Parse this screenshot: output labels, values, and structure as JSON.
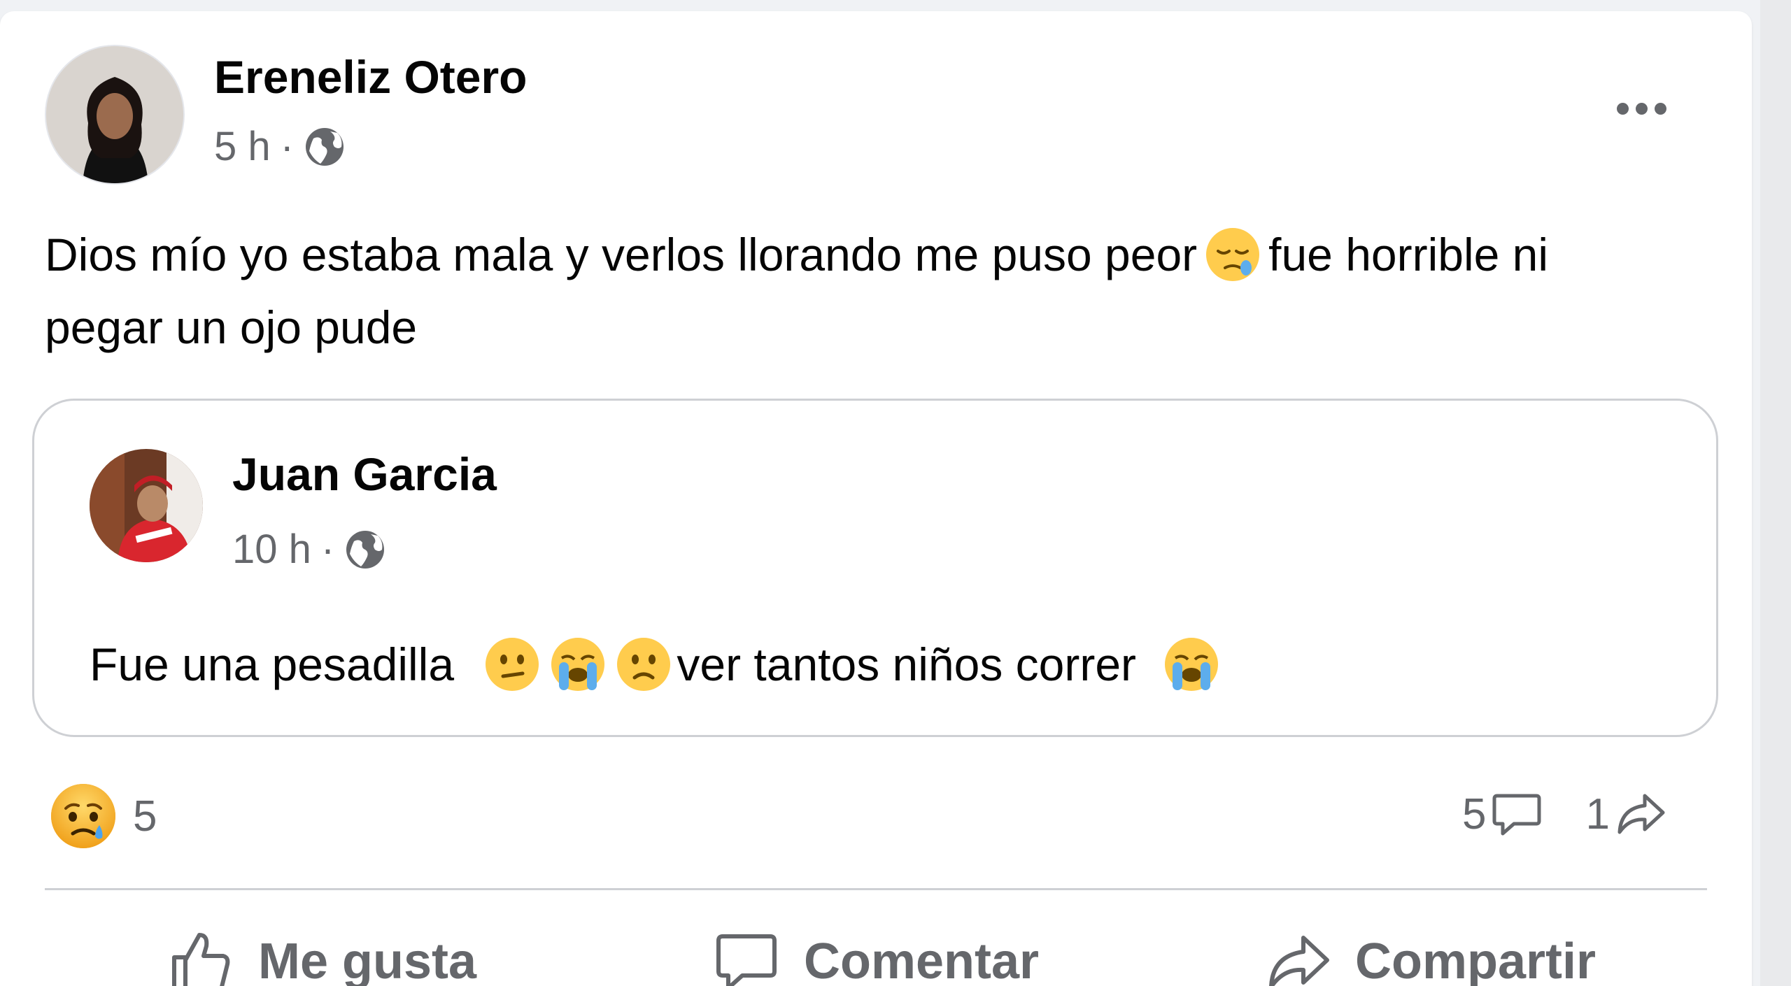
{
  "post": {
    "author": "Ereneliz Otero",
    "time": "5 h",
    "separator": "·",
    "text_part1": "Dios mío yo estaba mala y verlos llorando me puso peor",
    "text_part2": "fue horrible ni pegar un ojo pude",
    "icons": {
      "more": "more-options-icon",
      "audience": "globe-icon",
      "inline_emoji": "sleepy-face-emoji"
    }
  },
  "shared_post": {
    "author": "Juan Garcia",
    "time": "10 h",
    "separator": "·",
    "text_part1": "Fue una pesadilla",
    "text_part2": "ver tantos niños correr",
    "emojis": [
      "confused-face-emoji",
      "loudly-crying-face-emoji",
      "frowning-face-emoji",
      "loudly-crying-face-emoji"
    ]
  },
  "stats": {
    "reaction_count": "5",
    "reaction_icon": "sad-reaction-icon",
    "comment_count": "5",
    "share_count": "1"
  },
  "actions": {
    "like": "Me gusta",
    "comment": "Comentar",
    "share": "Compartir"
  },
  "colors": {
    "text_primary": "#050505",
    "text_secondary": "#65676b",
    "divider": "#ced0d4",
    "background": "#f0f2f5",
    "card": "#ffffff"
  }
}
